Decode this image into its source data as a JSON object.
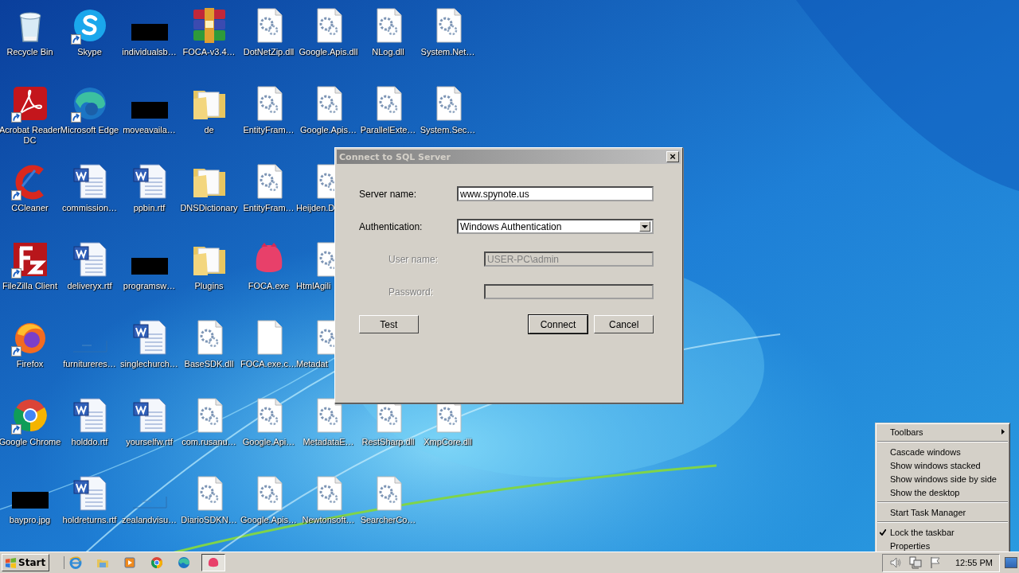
{
  "desktop": {
    "rows": [
      [
        {
          "label": "Recycle Bin",
          "kind": "bin",
          "shortcut": false
        },
        {
          "label": "Skype",
          "kind": "skype",
          "shortcut": true
        },
        {
          "label": "individualsb…",
          "kind": "redacted",
          "shortcut": false
        },
        {
          "label": "FOCA-v3.4…",
          "kind": "archive",
          "shortcut": false
        },
        {
          "label": "DotNetZip.dll",
          "kind": "dll",
          "shortcut": false
        },
        {
          "label": "Google.Apis.dll",
          "kind": "dll",
          "shortcut": false
        },
        {
          "label": "NLog.dll",
          "kind": "dll",
          "shortcut": false
        },
        {
          "label": "System.Net…",
          "kind": "dll",
          "shortcut": false
        }
      ],
      [
        {
          "label": "Acrobat Reader DC",
          "kind": "acrobat",
          "shortcut": true
        },
        {
          "label": "Microsoft Edge",
          "kind": "edge",
          "shortcut": true
        },
        {
          "label": "moveavaila…",
          "kind": "redacted",
          "shortcut": false
        },
        {
          "label": "de",
          "kind": "folder",
          "shortcut": false
        },
        {
          "label": "EntityFram…",
          "kind": "dll",
          "shortcut": false
        },
        {
          "label": "Google.Apis…",
          "kind": "dll",
          "shortcut": false
        },
        {
          "label": "ParallelExte…",
          "kind": "dll",
          "shortcut": false
        },
        {
          "label": "System.Sec…",
          "kind": "dll",
          "shortcut": false
        }
      ],
      [
        {
          "label": "CCleaner",
          "kind": "ccleaner",
          "shortcut": true
        },
        {
          "label": "commission…",
          "kind": "word",
          "shortcut": false
        },
        {
          "label": "ppbin.rtf",
          "kind": "word",
          "shortcut": false
        },
        {
          "label": "DNSDictionary",
          "kind": "folder",
          "shortcut": false
        },
        {
          "label": "EntityFram…",
          "kind": "dll",
          "shortcut": false
        },
        {
          "label": "Heijden.D",
          "kind": "dll",
          "shortcut": false,
          "clipped": true
        }
      ],
      [
        {
          "label": "FileZilla Client",
          "kind": "filezilla",
          "shortcut": true
        },
        {
          "label": "deliveryx.rtf",
          "kind": "word",
          "shortcut": false
        },
        {
          "label": "programsw…",
          "kind": "redacted",
          "shortcut": false
        },
        {
          "label": "Plugins",
          "kind": "folder",
          "shortcut": false
        },
        {
          "label": "FOCA.exe",
          "kind": "foca",
          "shortcut": false
        },
        {
          "label": "HtmlAgili",
          "kind": "dll",
          "shortcut": false,
          "clipped": true
        }
      ],
      [
        {
          "label": "Firefox",
          "kind": "firefox",
          "shortcut": true
        },
        {
          "label": "furnitureres…",
          "kind": "faint",
          "shortcut": false
        },
        {
          "label": "singlechurch…",
          "kind": "word",
          "shortcut": false
        },
        {
          "label": "BaseSDK.dll",
          "kind": "dll",
          "shortcut": false
        },
        {
          "label": "FOCA.exe.c…",
          "kind": "blank",
          "shortcut": false
        },
        {
          "label": "Metadat",
          "kind": "dll",
          "shortcut": false,
          "clipped": true
        }
      ],
      [
        {
          "label": "Google Chrome",
          "kind": "chrome",
          "shortcut": true
        },
        {
          "label": "holddo.rtf",
          "kind": "word",
          "shortcut": false
        },
        {
          "label": "yourselfw.rtf",
          "kind": "word",
          "shortcut": false
        },
        {
          "label": "com.rusanu…",
          "kind": "dll",
          "shortcut": false
        },
        {
          "label": "Google.Api…",
          "kind": "dll",
          "shortcut": false
        },
        {
          "label": "MetadataE…",
          "kind": "dll",
          "shortcut": false
        },
        {
          "label": "RestSharp.dll",
          "kind": "dll",
          "shortcut": false
        },
        {
          "label": "XmpCore.dll",
          "kind": "dll",
          "shortcut": false
        }
      ],
      [
        {
          "label": "baypro.jpg",
          "kind": "redacted",
          "shortcut": false
        },
        {
          "label": "holdreturns.rtf",
          "kind": "word",
          "shortcut": false
        },
        {
          "label": "zealandvisu…",
          "kind": "faint",
          "shortcut": false
        },
        {
          "label": "DiarioSDKN…",
          "kind": "dll",
          "shortcut": false
        },
        {
          "label": "Google.Apis…",
          "kind": "dll",
          "shortcut": false
        },
        {
          "label": "Newtonsoft…",
          "kind": "dll",
          "shortcut": false
        },
        {
          "label": "SearcherCo…",
          "kind": "dll",
          "shortcut": false
        }
      ]
    ]
  },
  "dialog": {
    "title": "Connect to SQL Server",
    "close": "×",
    "fields": [
      {
        "label": "Server name:",
        "kind": "text",
        "value": "www.spynote.us",
        "disabled": false
      },
      {
        "label": "Authentication:",
        "kind": "select",
        "value": "Windows Authentication",
        "disabled": false
      },
      {
        "label": "User name:",
        "kind": "text",
        "value": "USER-PC\\admin",
        "disabled": true
      },
      {
        "label": "Password:",
        "kind": "password",
        "disabled": true
      }
    ],
    "buttons": [
      {
        "label": "Test",
        "default": false
      },
      {
        "label": "Connect",
        "default": true
      },
      {
        "label": "Cancel",
        "default": false
      }
    ]
  },
  "context_menu": {
    "items": [
      {
        "kind": "item",
        "label": "Toolbars",
        "submenu": true,
        "checked": false
      },
      {
        "kind": "separator"
      },
      {
        "kind": "item",
        "label": "Cascade windows",
        "submenu": false,
        "checked": false
      },
      {
        "kind": "item",
        "label": "Show windows stacked",
        "submenu": false,
        "checked": false
      },
      {
        "kind": "item",
        "label": "Show windows side by side",
        "submenu": false,
        "checked": false
      },
      {
        "kind": "item",
        "label": "Show the desktop",
        "submenu": false,
        "checked": false
      },
      {
        "kind": "separator"
      },
      {
        "kind": "item",
        "label": "Start Task Manager",
        "submenu": false,
        "checked": false
      },
      {
        "kind": "separator"
      },
      {
        "kind": "item",
        "label": "Lock the taskbar",
        "submenu": false,
        "checked": true
      },
      {
        "kind": "item",
        "label": "Properties",
        "submenu": false,
        "checked": false
      }
    ]
  },
  "taskbar": {
    "start": "Start",
    "quick_launch": [
      {
        "kind": "ie"
      },
      {
        "kind": "explorer"
      },
      {
        "kind": "media"
      },
      {
        "kind": "chrome"
      },
      {
        "kind": "edge"
      }
    ],
    "tasks": [
      {
        "kind": "foca",
        "selected": true
      }
    ],
    "tray": [
      {
        "kind": "speaker"
      },
      {
        "kind": "network"
      },
      {
        "kind": "flag"
      }
    ],
    "clock": "12:55 PM"
  }
}
